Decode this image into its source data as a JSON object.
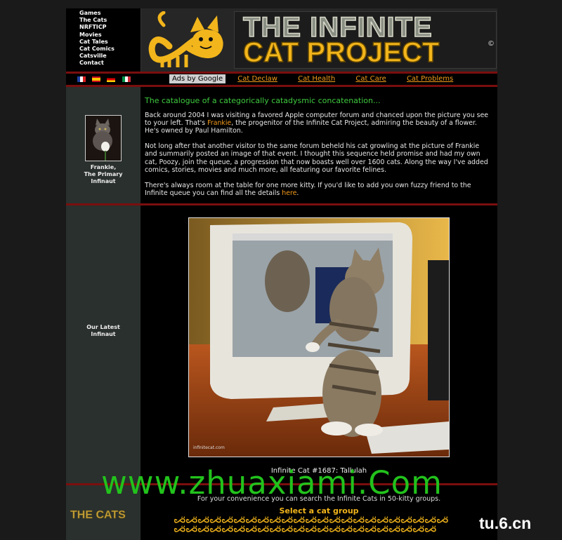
{
  "nav": {
    "items": [
      "Games",
      "The Cats",
      "NRFTICP",
      "Movies",
      "Cat Tales",
      "Cat Comics",
      "Catsville",
      "Contact"
    ]
  },
  "header": {
    "title_line1": "THE INFINITE",
    "title_line2": "CAT PROJECT",
    "copyright": "©"
  },
  "languages": [
    "french-flag",
    "spanish-flag",
    "german-flag",
    "italian-flag"
  ],
  "adbar": {
    "ads_label": "Ads by Google",
    "links": [
      "Cat Declaw",
      "Cat Health",
      "Cat Care",
      "Cat Problems"
    ]
  },
  "intro": {
    "tagline": "The catalogue of a categorically catadysmic concatenation...",
    "p1_before": "Back around 2004 I was visiting a favored Apple computer forum and chanced upon the picture you see to your left. That's ",
    "p1_link": "Frankie",
    "p1_after": ", the progenitor of the Infinite Cat Project, admiring the beauty of a flower. He's owned by Paul Hamilton.",
    "p2": "Not long after that another visitor to the same forum beheld his cat growling at the picture of Frankie and summarily posted an image of that event. I thought this sequence held promise and had my own cat, Poozy, join the queue, a progression that now boasts well over 1600 cats. Along the way I've added comics, stories, movies and much more, all featuring our favorite felines.",
    "p3_before": "There's always room at the table for one more kitty. If you'd like to add you own fuzzy friend to the Infinite queue you can find all the details ",
    "p3_link": "here",
    "p3_after": "."
  },
  "frankie": {
    "caption_line1": "Frankie,",
    "caption_line2": "The Primary",
    "caption_line3": "Infinaut"
  },
  "latest": {
    "caption_line1": "Our Latest",
    "caption_line2": "Infinaut",
    "photo_caption": "Infinite Cat #1687: Tallulah",
    "photo_watermark": "infinitecat.com"
  },
  "groups": {
    "logo_text": "THE CATS",
    "intro_text": "For your convenience you can search the Infinite Cats in 50-kitty groups.",
    "select_label": "Select a cat group",
    "row1_count": 23,
    "row2_count": 22
  },
  "watermarks": {
    "site": "www.zhuaxiami.Com",
    "corner": "tu.6.cn"
  },
  "colors": {
    "accent_orange": "#f39a1a",
    "tagline_green": "#3ec93e",
    "divider_red": "#7a0e0e",
    "sidebar_panel": "#2a302d"
  }
}
